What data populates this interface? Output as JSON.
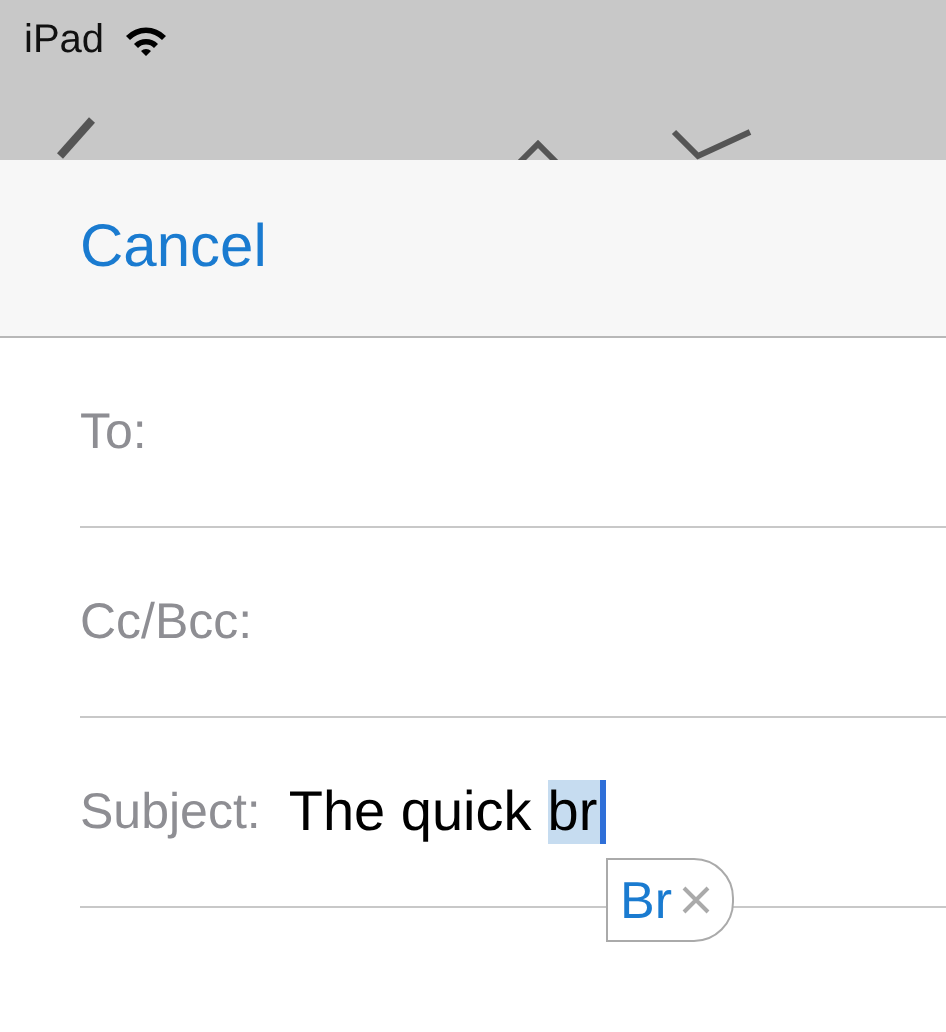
{
  "status_bar": {
    "device": "iPad"
  },
  "compose": {
    "cancel": "Cancel",
    "fields": [
      {
        "label": "To:"
      },
      {
        "label": "Cc/Bcc:"
      },
      {
        "label": "Subject:",
        "value": "The quick",
        "marked_text": "br"
      }
    ],
    "suggestion": {
      "text": "Br"
    }
  }
}
